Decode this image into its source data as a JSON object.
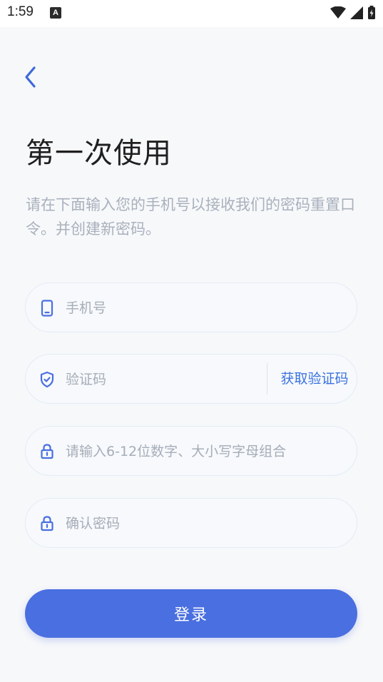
{
  "status_bar": {
    "time": "1:59",
    "notification_icon": "A"
  },
  "header": {
    "back_icon": "chevron-left-icon",
    "title": "第一次使用"
  },
  "description": "请在下面输入您的手机号以接收我们的密码重置口令。并创建新密码。",
  "form": {
    "phone": {
      "placeholder": "手机号",
      "value": ""
    },
    "code": {
      "placeholder": "验证码",
      "value": "",
      "get_code_label": "获取验证码"
    },
    "password": {
      "placeholder": "请输入6-12位数字、大小写字母组合",
      "value": ""
    },
    "confirm_password": {
      "placeholder": "确认密码",
      "value": ""
    }
  },
  "login_button": {
    "label": "登录"
  },
  "colors": {
    "accent": "#4a6fe0",
    "link": "#3b73e0",
    "icon": "#4a6fe0",
    "background": "#f7f8fa",
    "description_text": "#a9b1bd"
  }
}
